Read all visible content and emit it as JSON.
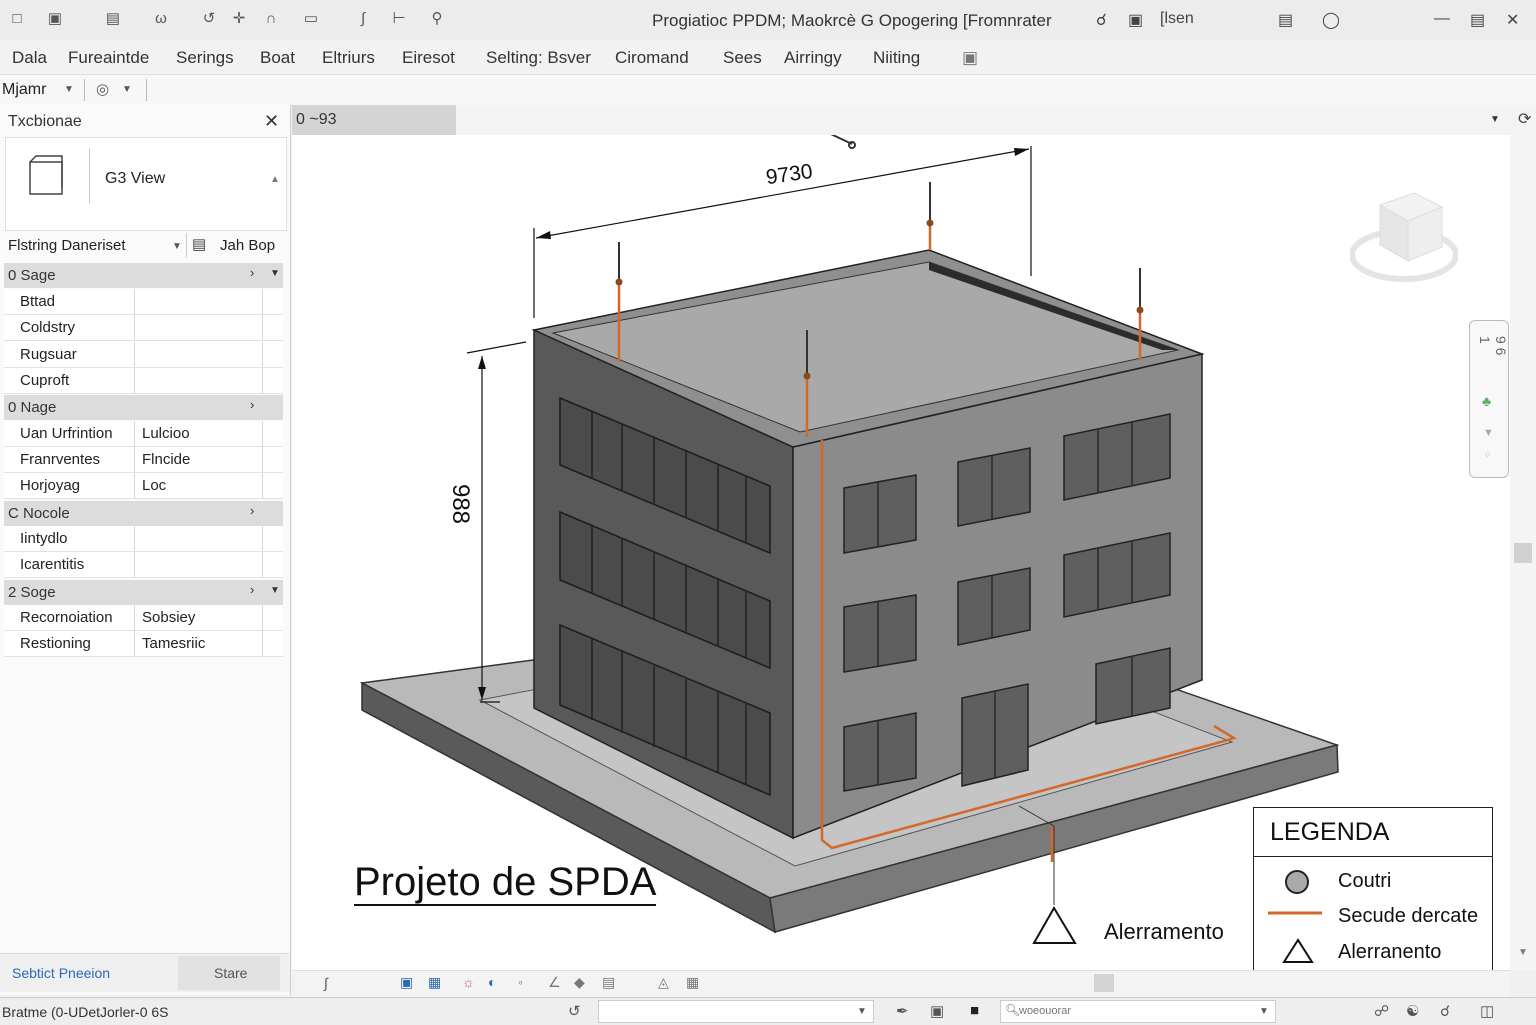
{
  "titlebar": {
    "title": "Progiatioc PPDM; Maokrcè G Opogering [Fromnrater",
    "user": "[lsen",
    "quick_access_icons": [
      "new-icon",
      "open-icon",
      "save-icon",
      "undo-icon",
      "redo-icon",
      "measure-icon",
      "tag-icon",
      "text-icon",
      "arrow-icon",
      "section-icon",
      "view-icon"
    ]
  },
  "menu": {
    "items": [
      "Dala",
      "Fureaintde",
      "Serings",
      "Boat",
      "Eltriurs",
      "Eiresot",
      "Selting: Bsver",
      "Ciromand",
      "Sees",
      "Airringy",
      "Niiting"
    ]
  },
  "toolbar": {
    "modify_label": "Mjamr"
  },
  "properties": {
    "title": "Txcbionae",
    "type_name": "G3 View",
    "filter_label": "Flstring Daneriset",
    "edit_type_label": "Jah Bop",
    "groups": [
      {
        "label": "0 Sage",
        "rows": [
          {
            "k": "Bttad",
            "v": ""
          },
          {
            "k": "Coldstry",
            "v": ""
          },
          {
            "k": "Rugsuar",
            "v": ""
          },
          {
            "k": "Cuproft",
            "v": ""
          }
        ]
      },
      {
        "label": "0 Nage",
        "rows": [
          {
            "k": "Uan Urfrintion",
            "v": "Lulcioo"
          },
          {
            "k": "Franrventes",
            "v": "Flncide"
          },
          {
            "k": "Horjoyag",
            "v": "Loc"
          }
        ]
      },
      {
        "label": "C Nocole",
        "rows": [
          {
            "k": "Iintydlo",
            "v": ""
          },
          {
            "k": "Icarentitis",
            "v": ""
          }
        ]
      },
      {
        "label": "2 Soge",
        "rows": [
          {
            "k": "Recornoiation",
            "v": "Sobsiey"
          },
          {
            "k": "Restioning",
            "v": "Tamesriic"
          }
        ]
      }
    ],
    "footer_link": "Sebtict Pneeion",
    "footer_button": "Stare"
  },
  "view": {
    "tab_label": "0 ~93",
    "dim_width": "9730",
    "dim_height": "988",
    "drawing_title": "Projeto de SPDA",
    "ground_label": "Alerramento",
    "nav_bar_text": "9 6 1",
    "legend": {
      "title": "LEGENDA",
      "items": [
        "Coutri",
        "Secude dercate",
        "Alerranento"
      ]
    },
    "colors": {
      "conductor": "#d2692a",
      "building_dark": "#555555",
      "building_light": "#8c8c8c",
      "roof": "#a9a9a9"
    }
  },
  "status": {
    "text": "Bratme (0-UDetJorler-0 6S",
    "search_placeholder": "woeouorar"
  }
}
